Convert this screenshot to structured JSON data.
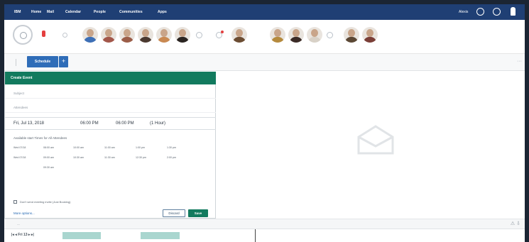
{
  "topnav": {
    "items": [
      "IBM",
      "Home",
      "Mail",
      "Calendar",
      "People",
      "Communities",
      "Apps"
    ],
    "user_name": "Alexis"
  },
  "avatar_bar": {
    "avatar_colors": [
      "#3d6fb6",
      "#a3574a",
      "#9b5d48",
      "#4b3930",
      "#c98952",
      "#2a2421",
      "#6b4c32",
      "#b58a3d",
      "#3b2b26",
      "#d8d1c7",
      "#5b4734",
      "#7a3e37"
    ]
  },
  "toolbar": {
    "schedule_label": "Schedule",
    "plus_label": "+",
    "overflow_label": "···"
  },
  "create_event": {
    "header": "Create Event",
    "subject_placeholder": "Subject",
    "attendees_placeholder": "Attendees",
    "date": "Fri, Jul 13, 2018",
    "start_time": "06:00 PM",
    "end_time": "06:00 PM",
    "duration": "(1 Hour)",
    "availability_title": "Available start Times for All Attendees",
    "slots": [
      {
        "day": "Wed 07/18",
        "times": [
          "08:00 am",
          "10:00 am",
          "11:00 am",
          "1:00 pm",
          "1:30 pm"
        ]
      },
      {
        "day": "Wed 07/18",
        "times": [
          "09:00 am",
          "10:30 am",
          "11:30 am",
          "12:30 pm",
          "2:00 pm"
        ]
      },
      {
        "day": "",
        "times": [
          "09:30 am"
        ]
      }
    ],
    "invite_text": "Don't send meeting invite (Just Booking)",
    "more_options": "More options...",
    "discard_label": "Discard",
    "save_label": "Save"
  },
  "bottom": {
    "timeline_nav": "|◂  ◂  Fri 13  ▸  ▸|"
  },
  "colors": {
    "nav_bg": "#1f3f74",
    "accent_green": "#127a5e",
    "primary_blue": "#2f6db8"
  }
}
